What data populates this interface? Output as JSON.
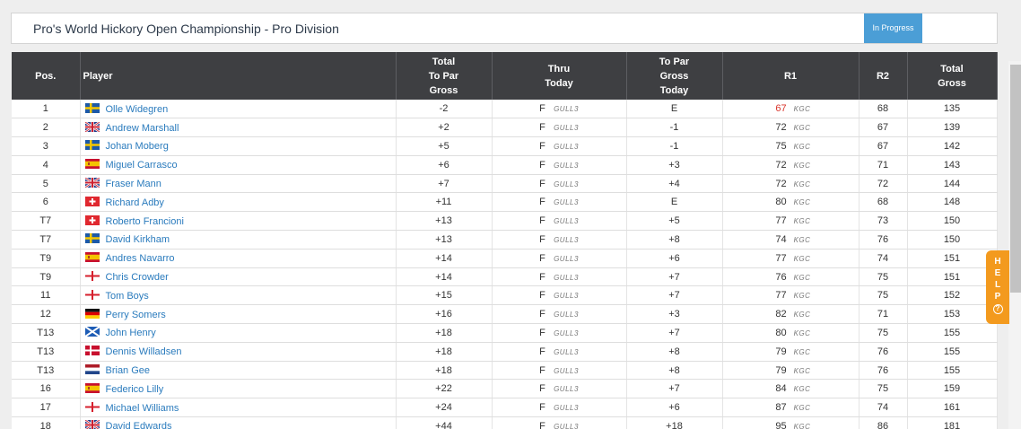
{
  "header": {
    "title": "Pro's World Hickory Open Championship - Pro Division",
    "status": "In Progress"
  },
  "table": {
    "columns": {
      "pos": "Pos.",
      "player": "Player",
      "total_to_par": [
        "Total",
        "To Par",
        "Gross"
      ],
      "thru": [
        "Thru",
        "Today"
      ],
      "to_par_today": [
        "To Par",
        "Gross",
        "Today"
      ],
      "r1": "R1",
      "r2": "R2",
      "total_gross": [
        "Total",
        "Gross"
      ]
    },
    "rows": [
      {
        "pos": "1",
        "flag": "se",
        "name": "Olle Widegren",
        "total": "-2",
        "thru": "F",
        "course": "GULL3",
        "today": "E",
        "r1": "67",
        "r1_course": "KGC",
        "r2": "68",
        "gross": "135"
      },
      {
        "pos": "2",
        "flag": "gb",
        "name": "Andrew Marshall",
        "total": "+2",
        "thru": "F",
        "course": "GULL3",
        "today": "-1",
        "r1": "72",
        "r1_course": "KGC",
        "r2": "67",
        "gross": "139"
      },
      {
        "pos": "3",
        "flag": "se",
        "name": "Johan Moberg",
        "total": "+5",
        "thru": "F",
        "course": "GULL3",
        "today": "-1",
        "r1": "75",
        "r1_course": "KGC",
        "r2": "67",
        "gross": "142"
      },
      {
        "pos": "4",
        "flag": "es",
        "name": "Miguel Carrasco",
        "total": "+6",
        "thru": "F",
        "course": "GULL3",
        "today": "+3",
        "r1": "72",
        "r1_course": "KGC",
        "r2": "71",
        "gross": "143"
      },
      {
        "pos": "5",
        "flag": "gb",
        "name": "Fraser Mann",
        "total": "+7",
        "thru": "F",
        "course": "GULL3",
        "today": "+4",
        "r1": "72",
        "r1_course": "KGC",
        "r2": "72",
        "gross": "144"
      },
      {
        "pos": "6",
        "flag": "ch",
        "name": "Richard Adby",
        "total": "+11",
        "thru": "F",
        "course": "GULL3",
        "today": "E",
        "r1": "80",
        "r1_course": "KGC",
        "r2": "68",
        "gross": "148"
      },
      {
        "pos": "T7",
        "flag": "ch",
        "name": "Roberto Francioni",
        "total": "+13",
        "thru": "F",
        "course": "GULL3",
        "today": "+5",
        "r1": "77",
        "r1_course": "KGC",
        "r2": "73",
        "gross": "150"
      },
      {
        "pos": "T7",
        "flag": "se",
        "name": "David Kirkham",
        "total": "+13",
        "thru": "F",
        "course": "GULL3",
        "today": "+8",
        "r1": "74",
        "r1_course": "KGC",
        "r2": "76",
        "gross": "150"
      },
      {
        "pos": "T9",
        "flag": "es",
        "name": "Andres Navarro",
        "total": "+14",
        "thru": "F",
        "course": "GULL3",
        "today": "+6",
        "r1": "77",
        "r1_course": "KGC",
        "r2": "74",
        "gross": "151"
      },
      {
        "pos": "T9",
        "flag": "en",
        "name": "Chris Crowder",
        "total": "+14",
        "thru": "F",
        "course": "GULL3",
        "today": "+7",
        "r1": "76",
        "r1_course": "KGC",
        "r2": "75",
        "gross": "151"
      },
      {
        "pos": "11",
        "flag": "en",
        "name": "Tom Boys",
        "total": "+15",
        "thru": "F",
        "course": "GULL3",
        "today": "+7",
        "r1": "77",
        "r1_course": "KGC",
        "r2": "75",
        "gross": "152"
      },
      {
        "pos": "12",
        "flag": "de",
        "name": "Perry Somers",
        "total": "+16",
        "thru": "F",
        "course": "GULL3",
        "today": "+3",
        "r1": "82",
        "r1_course": "KGC",
        "r2": "71",
        "gross": "153"
      },
      {
        "pos": "T13",
        "flag": "sc",
        "name": "John Henry",
        "total": "+18",
        "thru": "F",
        "course": "GULL3",
        "today": "+7",
        "r1": "80",
        "r1_course": "KGC",
        "r2": "75",
        "gross": "155"
      },
      {
        "pos": "T13",
        "flag": "dk",
        "name": "Dennis Willadsen",
        "total": "+18",
        "thru": "F",
        "course": "GULL3",
        "today": "+8",
        "r1": "79",
        "r1_course": "KGC",
        "r2": "76",
        "gross": "155"
      },
      {
        "pos": "T13",
        "flag": "nl",
        "name": "Brian Gee",
        "total": "+18",
        "thru": "F",
        "course": "GULL3",
        "today": "+8",
        "r1": "79",
        "r1_course": "KGC",
        "r2": "76",
        "gross": "155"
      },
      {
        "pos": "16",
        "flag": "es",
        "name": "Federico Lilly",
        "total": "+22",
        "thru": "F",
        "course": "GULL3",
        "today": "+7",
        "r1": "84",
        "r1_course": "KGC",
        "r2": "75",
        "gross": "159"
      },
      {
        "pos": "17",
        "flag": "en",
        "name": "Michael Williams",
        "total": "+24",
        "thru": "F",
        "course": "GULL3",
        "today": "+6",
        "r1": "87",
        "r1_course": "KGC",
        "r2": "74",
        "gross": "161"
      },
      {
        "pos": "18",
        "flag": "gb",
        "name": "David Edwards",
        "total": "+44",
        "thru": "F",
        "course": "GULL3",
        "today": "+18",
        "r1": "95",
        "r1_course": "KGC",
        "r2": "86",
        "gross": "181"
      }
    ]
  },
  "help": {
    "letters": [
      "H",
      "E",
      "L",
      "P"
    ],
    "icon": "question-circle-icon"
  },
  "colors": {
    "under_par": "#d9342b",
    "even_par": "#2f3a9e",
    "link": "#2a7bbd",
    "header_bg": "#3e3f42",
    "badge": "#4b9ed6",
    "help": "#f39a1e"
  }
}
